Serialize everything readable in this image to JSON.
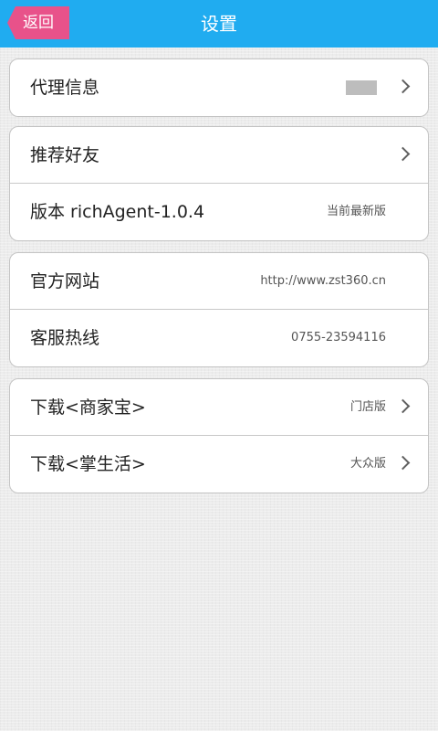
{
  "header": {
    "back_label": "返回",
    "title": "设置",
    "color": "#20acf0",
    "back_color": "#e8528a"
  },
  "groups": [
    {
      "items": [
        {
          "label": "代理信息",
          "value": "",
          "icon": "chevron-right-icon"
        }
      ]
    },
    {
      "items": [
        {
          "label": "推荐好友",
          "value": "",
          "icon": "chevron-right-icon"
        },
        {
          "label": "版本  richAgent-1.0.4",
          "value": "当前最新版"
        }
      ]
    },
    {
      "items": [
        {
          "label": "官方网站",
          "value": "http://www.zst360.cn"
        },
        {
          "label": "客服热线",
          "value": "0755-23594116"
        }
      ]
    },
    {
      "items": [
        {
          "label": "下载<商家宝>",
          "value": "门店版",
          "icon": "chevron-right-icon"
        },
        {
          "label": "下载<掌生活>",
          "value": "大众版",
          "icon": "chevron-right-icon"
        }
      ]
    }
  ]
}
